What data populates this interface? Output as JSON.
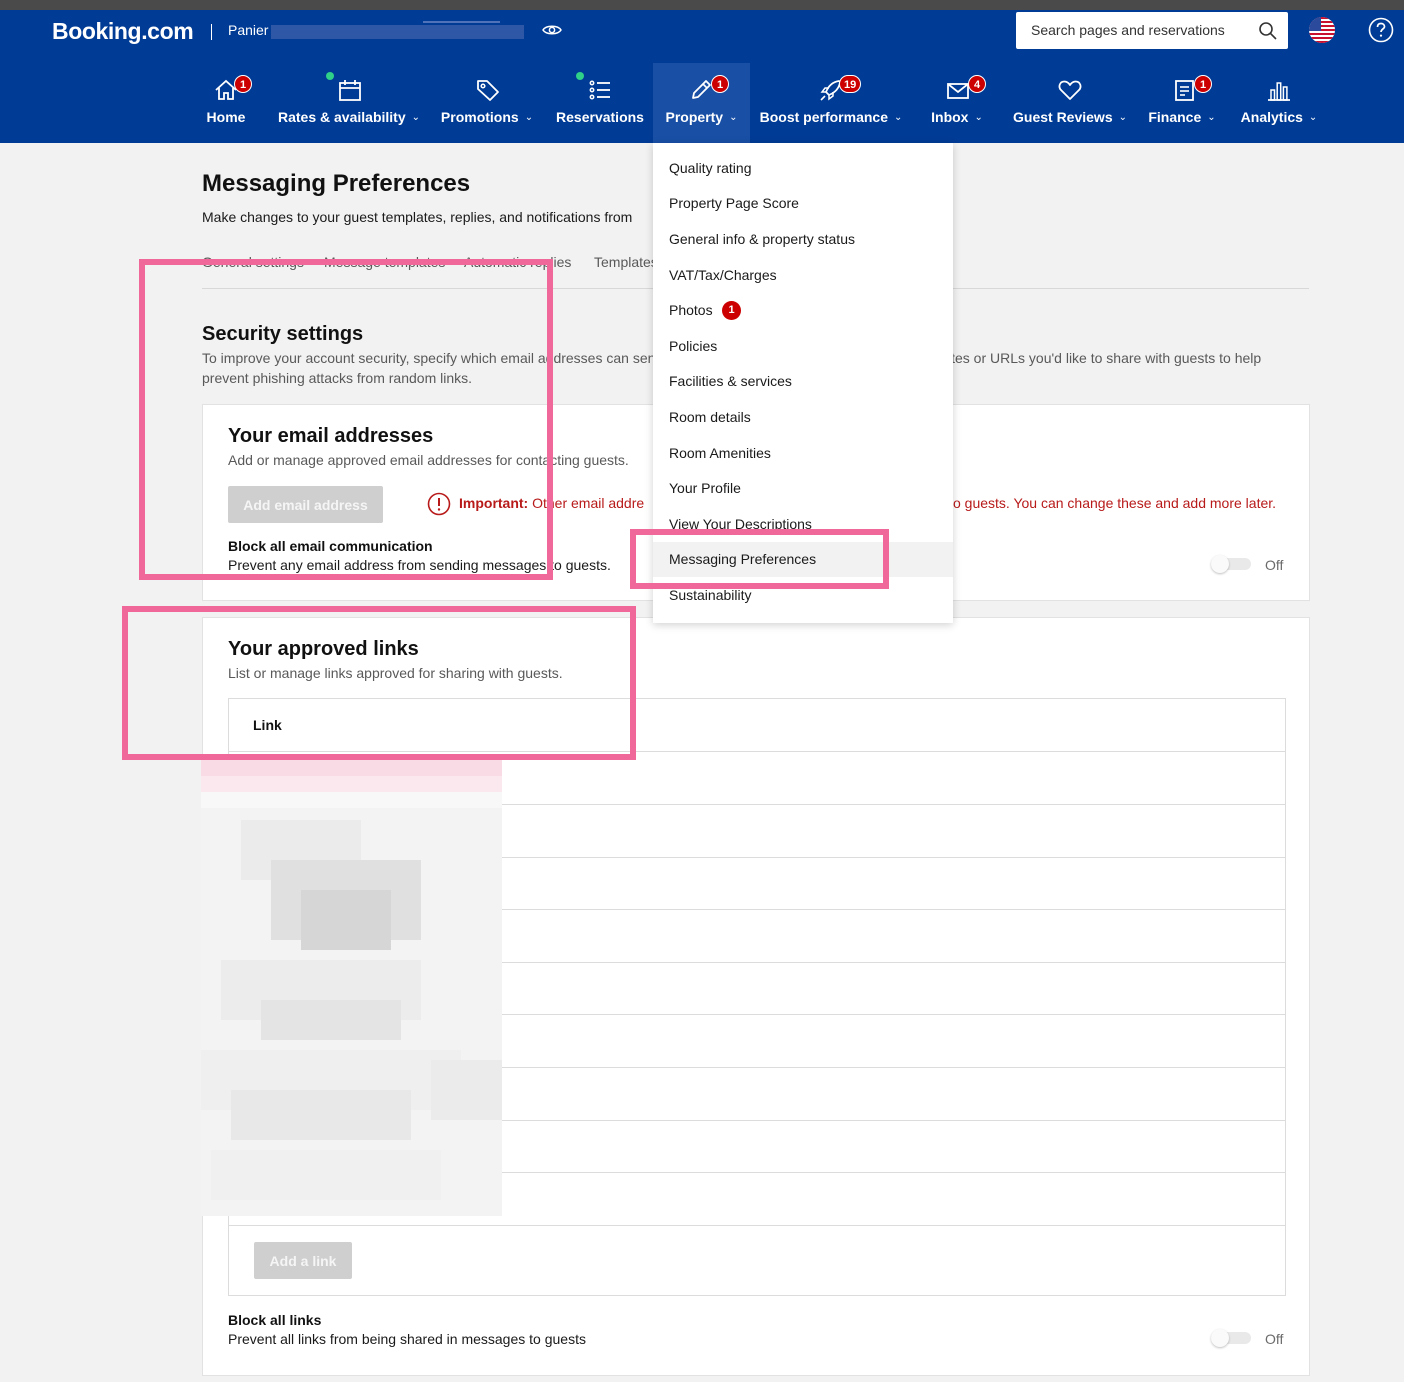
{
  "header": {
    "logo": "Booking.com",
    "property_name": "Panier",
    "search": {
      "placeholder": "Search pages and reservations"
    }
  },
  "nav": [
    {
      "label": "Home",
      "badge": "1"
    },
    {
      "label": "Rates & availability",
      "dot": true
    },
    {
      "label": "Promotions"
    },
    {
      "label": "Reservations",
      "dot": true
    },
    {
      "label": "Property",
      "badge": "1",
      "active": true
    },
    {
      "label": "Boost performance",
      "badge": "19"
    },
    {
      "label": "Inbox",
      "badge": "4"
    },
    {
      "label": "Guest Reviews"
    },
    {
      "label": "Finance",
      "badge": "1"
    },
    {
      "label": "Analytics"
    }
  ],
  "page": {
    "title": "Messaging Preferences",
    "subtitle": "Make changes to your guest templates, replies, and notifications from",
    "tabs": [
      "General settings",
      "Message templates",
      "Automatic replies",
      "Templates"
    ]
  },
  "security": {
    "title": "Security settings",
    "description": "To improve your account security, specify which email addresses can send messages to guests, and choose which websites or URLs you'd like to share with guests to help prevent phishing attacks from random links.",
    "email_card": {
      "title": "Your email addresses",
      "description": "Add or manage approved email addresses for contacting guests.",
      "add_button": "Add email address",
      "important_label": "Important:",
      "important_text": "Other email addre",
      "important_text_tail": "o guests. You can change these and add more later.",
      "block_title": "Block all email communication",
      "block_desc": "Prevent any email address from sending messages to guests.",
      "toggle_state": "Off"
    },
    "links_card": {
      "title": "Your approved links",
      "description": "List or manage links approved for sharing with guests.",
      "column_header": "Link",
      "add_button": "Add a link",
      "block_title": "Block all links",
      "block_desc": "Prevent all links from being shared in messages to guests",
      "toggle_state": "Off"
    }
  },
  "property_menu": [
    {
      "label": "Quality rating"
    },
    {
      "label": "Property Page Score"
    },
    {
      "label": "General info & property status"
    },
    {
      "label": "VAT/Tax/Charges"
    },
    {
      "label": "Photos",
      "badge": "1"
    },
    {
      "label": "Policies"
    },
    {
      "label": "Facilities & services"
    },
    {
      "label": "Room details"
    },
    {
      "label": "Room Amenities"
    },
    {
      "label": "Your Profile"
    },
    {
      "label": "View Your Descriptions"
    },
    {
      "label": "Messaging Preferences",
      "active": true
    },
    {
      "label": "Sustainability"
    }
  ],
  "colors": {
    "brand_blue": "#003b95",
    "active_nav": "#194fa5",
    "badge_red": "#cc0000",
    "highlight_pink": "#f0679a",
    "warning_red": "#b81a1a"
  },
  "icons": [
    "home-icon",
    "calendar-icon",
    "tag-icon",
    "list-icon",
    "pencil-icon",
    "rocket-icon",
    "envelope-icon",
    "heart-icon",
    "document-icon",
    "bar-chart-icon",
    "search-icon",
    "eye-icon",
    "us-flag-icon",
    "help-icon",
    "warning-icon"
  ]
}
